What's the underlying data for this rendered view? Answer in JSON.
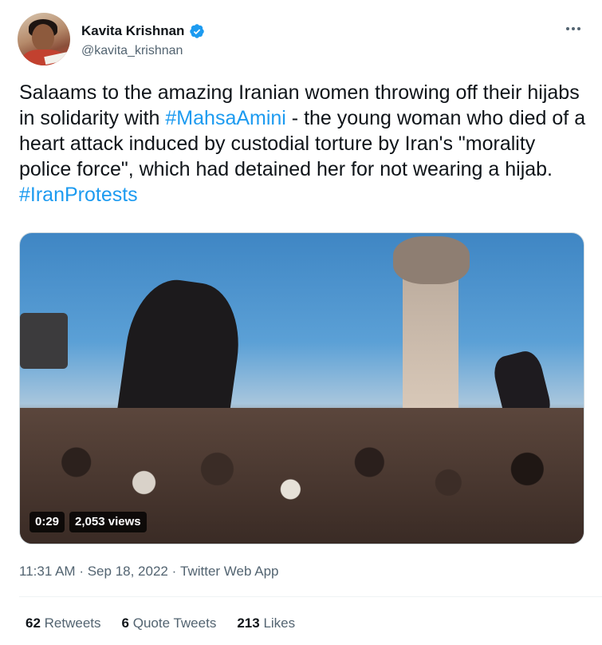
{
  "author": {
    "display_name": "Kavita Krishnan",
    "handle": "@kavita_krishnan",
    "verified": true,
    "icons": {
      "verified": "verified-badge-icon",
      "more": "more-options-icon"
    }
  },
  "tweet": {
    "segments": [
      {
        "type": "text",
        "value": "Salaams to the amazing Iranian women throwing off their hijabs in solidarity with "
      },
      {
        "type": "hashtag",
        "value": "#MahsaAmini"
      },
      {
        "type": "text",
        "value": " - the young woman who died of a heart attack induced by custodial torture by Iran's \"morality police force\", which had detained her for not wearing a hijab. "
      },
      {
        "type": "hashtag",
        "value": "#IranProtests"
      }
    ]
  },
  "media": {
    "duration": "0:29",
    "views": "2,053 views"
  },
  "meta": {
    "time": "11:31 AM",
    "separator": "·",
    "date": "Sep 18, 2022",
    "source": "Twitter Web App"
  },
  "stats": [
    {
      "count": "62",
      "label": "Retweets"
    },
    {
      "count": "6",
      "label": "Quote Tweets"
    },
    {
      "count": "213",
      "label": "Likes"
    }
  ],
  "colors": {
    "accent": "#1d9bf0",
    "text_primary": "#0f1419",
    "text_secondary": "#536471",
    "divider": "#eff3f4"
  }
}
